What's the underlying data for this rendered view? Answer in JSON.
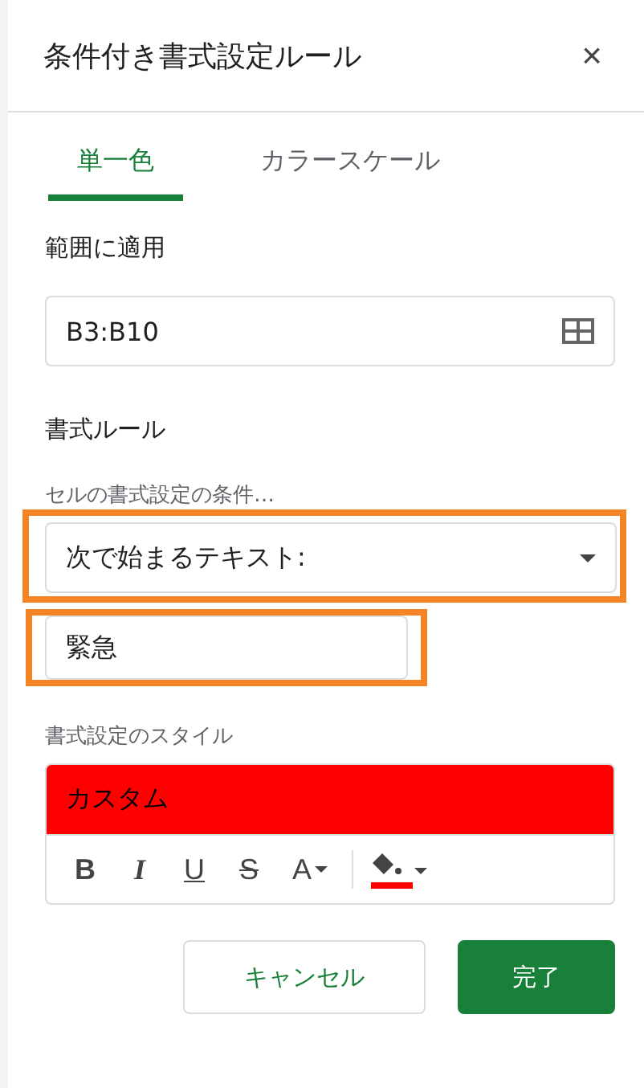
{
  "dialog": {
    "title": "条件付き書式設定ルール",
    "close": "×"
  },
  "tabs": [
    {
      "label": "単一色",
      "selected": true
    },
    {
      "label": "カラースケール",
      "selected": false
    }
  ],
  "range": {
    "label": "範囲に適用",
    "value": "B3:B10"
  },
  "rules": {
    "heading": "書式ルール",
    "condition_label": "セルの書式設定の条件…",
    "condition": {
      "value": "次で始まるテキスト:",
      "highlighted": true
    },
    "value_field": {
      "value": "緊急",
      "highlighted": true
    }
  },
  "style": {
    "label": "書式設定のスタイル",
    "preview_text": "カスタム",
    "color": "#ff0000",
    "toolbar": [
      {
        "kind": "bold",
        "label": "B"
      },
      {
        "kind": "italic",
        "label": "I"
      },
      {
        "kind": "underline",
        "label": "U"
      },
      {
        "kind": "strike",
        "label": "S"
      },
      {
        "kind": "text-color",
        "label": "A"
      },
      {
        "kind": "fill"
      }
    ]
  },
  "buttons": [
    {
      "kind": "secondary",
      "label": "キャンセル"
    },
    {
      "kind": "primary",
      "label": "完了"
    }
  ]
}
